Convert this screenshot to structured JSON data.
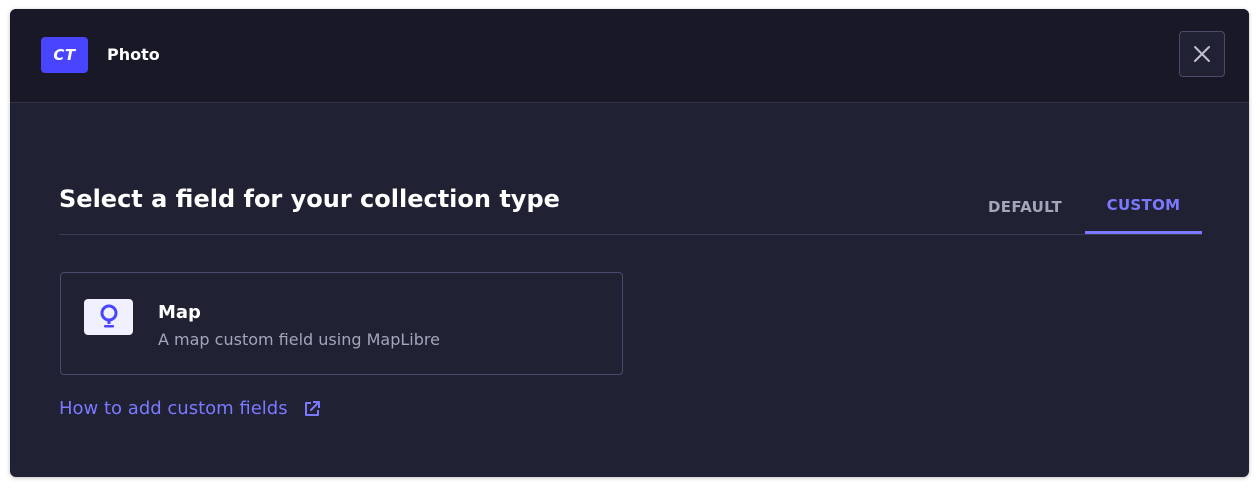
{
  "header": {
    "badge": "CT",
    "title": "Photo",
    "close_icon": "close-icon"
  },
  "main": {
    "title": "Select a field for your collection type",
    "tabs": [
      {
        "label": "DEFAULT",
        "selected": false
      },
      {
        "label": "CUSTOM",
        "selected": true
      }
    ],
    "fields": [
      {
        "icon": "map-pin-icon",
        "name": "Map",
        "description": "A map custom field using MapLibre"
      }
    ],
    "help_link": {
      "label": "How to add custom fields",
      "icon": "external-link-icon"
    }
  },
  "colors": {
    "background": "#212134",
    "header_background": "#181826",
    "accent": "#7b79ff",
    "badge": "#4945ff",
    "muted_text": "#a5a5ba"
  }
}
